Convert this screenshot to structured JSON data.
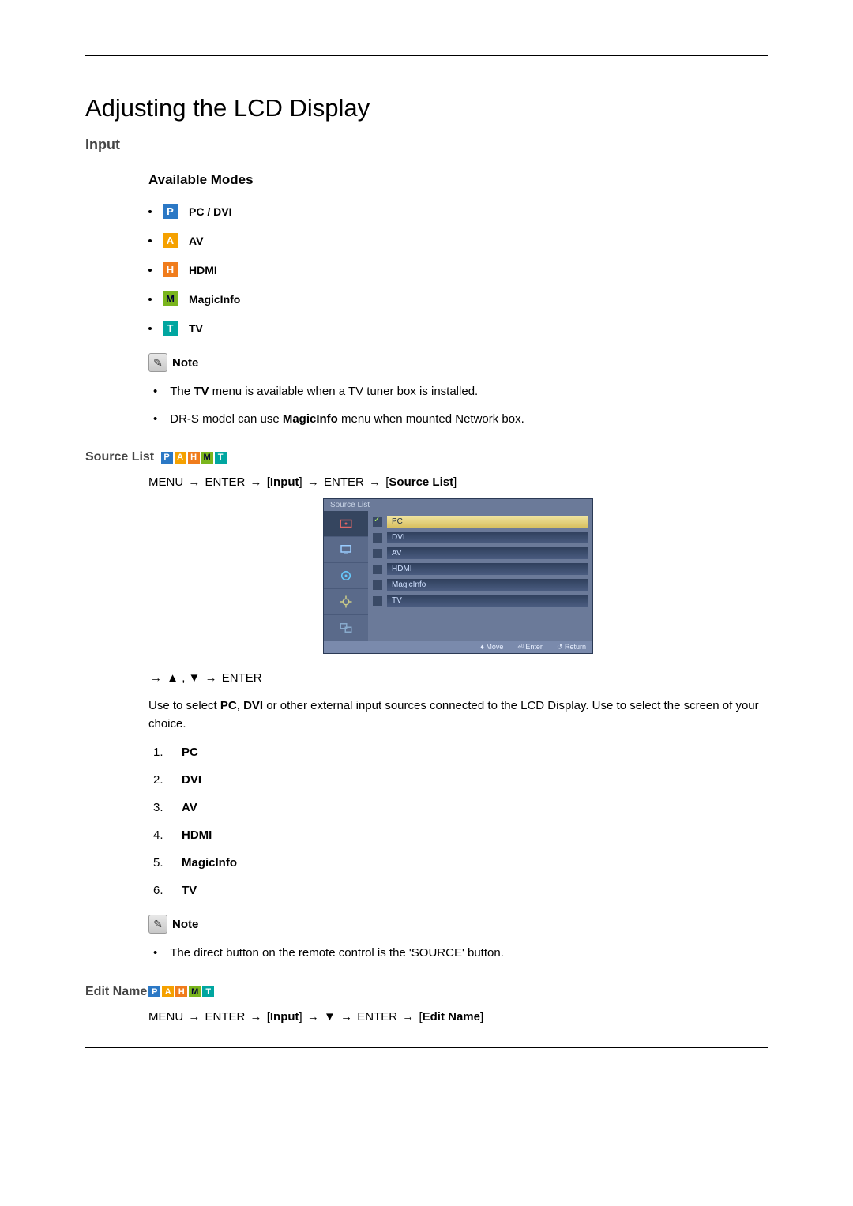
{
  "title": "Adjusting the LCD Display",
  "section_input": "Input",
  "available_modes_heading": "Available Modes",
  "modes": {
    "pc": {
      "letter": "P",
      "label": "PC / DVI"
    },
    "av": {
      "letter": "A",
      "label": "AV"
    },
    "hdmi": {
      "letter": "H",
      "label": "HDMI"
    },
    "magic": {
      "letter": "M",
      "label": "MagicInfo"
    },
    "tv": {
      "letter": "T",
      "label": "TV"
    }
  },
  "note_label": "Note",
  "notes1": {
    "a_pre": "The ",
    "a_bold": "TV",
    "a_post": " menu is available when a TV tuner box is installed.",
    "b_pre": "DR-S model can use ",
    "b_bold": "MagicInfo",
    "b_post": " menu when mounted Network box."
  },
  "source_list_heading": "Source List",
  "path1": {
    "menu": "MENU",
    "arrow": "→",
    "enter": "ENTER",
    "input_bold": "Input",
    "src_bold": "Source List",
    "open": "[",
    "close": "]"
  },
  "osd": {
    "title": "Source List",
    "items": [
      "PC",
      "DVI",
      "AV",
      "HDMI",
      "MagicInfo",
      "TV"
    ],
    "foot_move": "Move",
    "foot_enter": "Enter",
    "foot_return": "Return"
  },
  "arrows_line": {
    "arrow": "→",
    "up": "▲",
    "comma": " , ",
    "down": "▼",
    "enter": "ENTER"
  },
  "desc": {
    "pre": "Use to select ",
    "pc": "PC",
    "mid1": ", ",
    "dvi": "DVI",
    "post": " or other external input sources connected to the LCD Display. Use to select the screen of your choice."
  },
  "numlist": [
    "PC",
    "DVI",
    "AV",
    "HDMI",
    "MagicInfo",
    "TV"
  ],
  "notes2": {
    "text": "The direct button on the remote control is the 'SOURCE' button."
  },
  "edit_name_heading": "Edit Name",
  "path2": {
    "menu": "MENU",
    "arrow": "→",
    "enter": "ENTER",
    "input_bold": "Input",
    "down": "▼",
    "edit_bold": "Edit Name",
    "open": "[",
    "close": "]"
  }
}
